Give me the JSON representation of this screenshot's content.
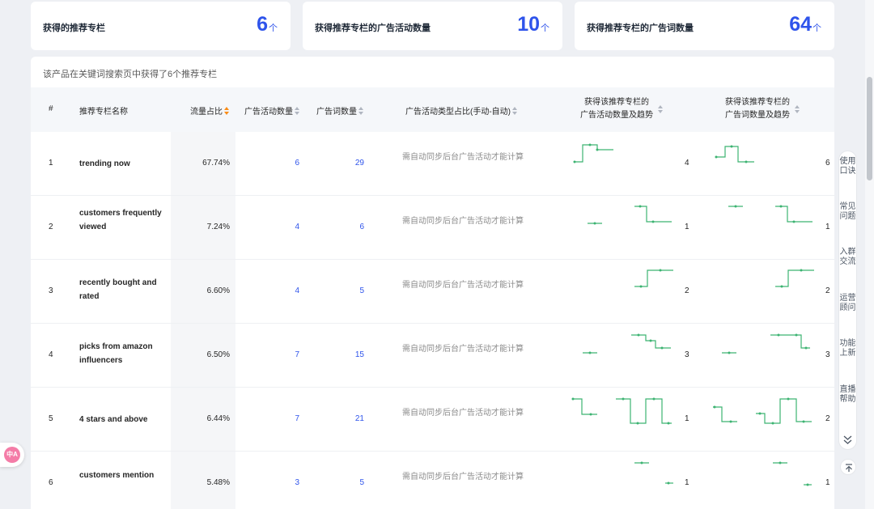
{
  "summary_cards": [
    {
      "label": "获得的推荐专栏",
      "value": "6",
      "unit": "个"
    },
    {
      "label": "获得推荐专栏的广告活动数量",
      "value": "10",
      "unit": "个"
    },
    {
      "label": "获得推荐专栏的广告词数量",
      "value": "64",
      "unit": "个"
    }
  ],
  "description": "该产品在关键词搜索页中获得了6个推荐专栏",
  "table": {
    "headers": {
      "index": "#",
      "name": "推荐专栏名称",
      "traffic_share": "流量占比",
      "campaign_count": "广告活动数量",
      "keyword_count": "广告词数量",
      "campaign_type": "广告活动类型占比(手动-自动)",
      "campaign_trend_line1": "获得该推荐专栏的",
      "campaign_trend_line2": "广告活动数量及趋势",
      "keyword_trend_line1": "获得该推荐专栏的",
      "keyword_trend_line2": "广告词数量及趋势"
    },
    "rows": [
      {
        "index": "1",
        "name": "trending now",
        "traffic_share": "67.74%",
        "campaigns": "6",
        "keywords": "29",
        "type_note": "需自动同步后台广告活动才能计算",
        "campaign_trend_count": "4",
        "keyword_trend_count": "6"
      },
      {
        "index": "2",
        "name": "customers frequently viewed",
        "traffic_share": "7.24%",
        "campaigns": "4",
        "keywords": "6",
        "type_note": "需自动同步后台广告活动才能计算",
        "campaign_trend_count": "1",
        "keyword_trend_count": "1"
      },
      {
        "index": "3",
        "name": "recently bought and rated",
        "traffic_share": "6.60%",
        "campaigns": "4",
        "keywords": "5",
        "type_note": "需自动同步后台广告活动才能计算",
        "campaign_trend_count": "2",
        "keyword_trend_count": "2"
      },
      {
        "index": "4",
        "name": "picks from amazon influencers",
        "traffic_share": "6.50%",
        "campaigns": "7",
        "keywords": "15",
        "type_note": "需自动同步后台广告活动才能计算",
        "campaign_trend_count": "3",
        "keyword_trend_count": "3"
      },
      {
        "index": "5",
        "name": "4 stars and above",
        "traffic_share": "6.44%",
        "campaigns": "7",
        "keywords": "21",
        "type_note": "需自动同步后台广告活动才能计算",
        "campaign_trend_count": "1",
        "keyword_trend_count": "2"
      },
      {
        "index": "6",
        "name": "customers mention",
        "traffic_share": "5.48%",
        "campaigns": "3",
        "keywords": "5",
        "type_note": "需自动同步后台广告活动才能计算",
        "campaign_trend_count": "1",
        "keyword_trend_count": "1"
      }
    ]
  },
  "sidebar": {
    "items": [
      "使用口诀",
      "常见问题",
      "入群交流",
      "运营顾问",
      "功能上新",
      "直播帮助"
    ]
  },
  "translate_badge": "中A",
  "colors": {
    "accent": "#2f54eb",
    "trend": "#3cb371",
    "sort_active": "#fa8c16"
  }
}
